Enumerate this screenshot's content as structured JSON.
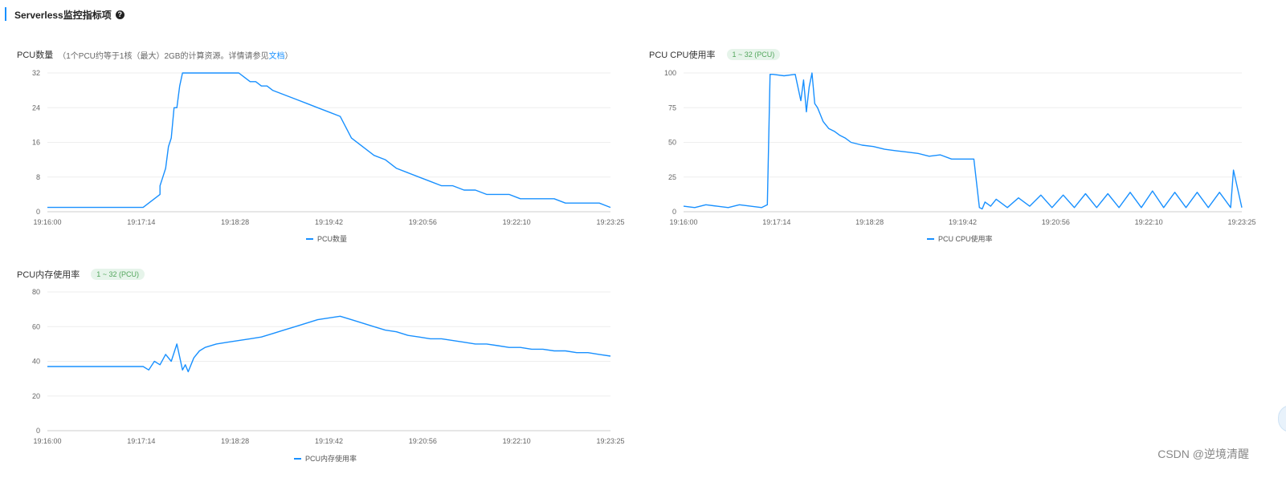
{
  "section": {
    "title": "Serverless监控指标项",
    "help_icon": "question-circle-icon"
  },
  "colors": {
    "series": "#1890ff",
    "badge_bg": "#e6f4ea",
    "badge_text": "#52a65c"
  },
  "charts": {
    "pcu": {
      "title": "PCU数量",
      "subtitle": "（1个PCU约等于1核（最大）2GB的计算资源。详情请参见",
      "link": "文档",
      "subtitle_end": "）",
      "legend": "PCU数量"
    },
    "cpu": {
      "title": "PCU CPU使用率",
      "badge": "1 ~ 32 (PCU)",
      "legend": "PCU CPU使用率"
    },
    "mem": {
      "title": "PCU内存使用率",
      "badge": "1 ~ 32 (PCU)",
      "legend": "PCU内存使用率"
    }
  },
  "watermark": "CSDN @逆境清醒",
  "chart_data": [
    {
      "id": "pcu",
      "type": "line",
      "title": "PCU数量",
      "x_ticks": [
        "19:16:00",
        "19:17:14",
        "19:18:28",
        "19:19:42",
        "19:20:56",
        "19:22:10",
        "19:23:25"
      ],
      "ylim": [
        0,
        32
      ],
      "y_ticks": [
        "0",
        "8",
        "16",
        "24",
        "32"
      ],
      "grid": true,
      "legend_position": "bottom",
      "series": [
        {
          "name": "PCU数量",
          "x": [
            0,
            0.17,
            0.18,
            0.19,
            0.2,
            0.2,
            0.205,
            0.21,
            0.215,
            0.22,
            0.225,
            0.23,
            0.235,
            0.24,
            0.245,
            0.25,
            0.255,
            0.26,
            0.27,
            0.28,
            0.29,
            0.3,
            0.31,
            0.32,
            0.33,
            0.34,
            0.35,
            0.36,
            0.37,
            0.38,
            0.39,
            0.4,
            0.42,
            0.44,
            0.46,
            0.48,
            0.5,
            0.52,
            0.54,
            0.56,
            0.58,
            0.6,
            0.62,
            0.64,
            0.66,
            0.68,
            0.7,
            0.72,
            0.74,
            0.76,
            0.78,
            0.8,
            0.82,
            0.84,
            0.86,
            0.88,
            0.9,
            0.92,
            0.94,
            0.96,
            0.98,
            1.0
          ],
          "y": [
            1,
            1,
            2,
            3,
            4,
            6,
            8,
            10,
            15,
            17,
            24,
            24,
            29,
            32,
            32,
            32,
            32,
            32,
            32,
            32,
            32,
            32,
            32,
            32,
            32,
            32,
            31,
            30,
            30,
            29,
            29,
            28,
            27,
            26,
            25,
            24,
            23,
            22,
            17,
            15,
            13,
            12,
            10,
            9,
            8,
            7,
            6,
            6,
            5,
            5,
            4,
            4,
            4,
            3,
            3,
            3,
            3,
            2,
            2,
            2,
            2,
            1
          ]
        }
      ]
    },
    {
      "id": "cpu",
      "type": "line",
      "title": "PCU CPU使用率",
      "x_ticks": [
        "19:16:00",
        "19:17:14",
        "19:18:28",
        "19:19:42",
        "19:20:56",
        "19:22:10",
        "19:23:25"
      ],
      "ylim": [
        0,
        100
      ],
      "y_ticks": [
        "0",
        "25",
        "50",
        "75",
        "100"
      ],
      "grid": true,
      "legend_position": "bottom",
      "series": [
        {
          "name": "PCU CPU使用率",
          "x": [
            0,
            0.02,
            0.04,
            0.06,
            0.08,
            0.1,
            0.12,
            0.14,
            0.15,
            0.155,
            0.16,
            0.18,
            0.2,
            0.21,
            0.215,
            0.22,
            0.225,
            0.23,
            0.235,
            0.24,
            0.245,
            0.25,
            0.26,
            0.27,
            0.28,
            0.29,
            0.3,
            0.32,
            0.34,
            0.36,
            0.38,
            0.4,
            0.42,
            0.44,
            0.46,
            0.48,
            0.5,
            0.52,
            0.53,
            0.535,
            0.54,
            0.55,
            0.56,
            0.58,
            0.6,
            0.62,
            0.64,
            0.66,
            0.68,
            0.7,
            0.72,
            0.74,
            0.76,
            0.78,
            0.8,
            0.82,
            0.84,
            0.86,
            0.88,
            0.9,
            0.92,
            0.94,
            0.96,
            0.98,
            0.985,
            1.0
          ],
          "y": [
            4,
            3,
            5,
            4,
            3,
            5,
            4,
            3,
            5,
            99,
            99,
            98,
            99,
            80,
            95,
            72,
            90,
            100,
            78,
            75,
            70,
            65,
            60,
            58,
            55,
            53,
            50,
            48,
            47,
            45,
            44,
            43,
            42,
            40,
            41,
            38,
            38,
            38,
            3,
            2,
            7,
            4,
            9,
            3,
            10,
            4,
            12,
            3,
            12,
            3,
            13,
            3,
            13,
            3,
            14,
            3,
            15,
            3,
            14,
            3,
            14,
            3,
            14,
            3,
            30,
            3
          ]
        }
      ]
    },
    {
      "id": "mem",
      "type": "line",
      "title": "PCU内存使用率",
      "x_ticks": [
        "19:16:00",
        "19:17:14",
        "19:18:28",
        "19:19:42",
        "19:20:56",
        "19:22:10",
        "19:23:25"
      ],
      "ylim": [
        0,
        80
      ],
      "y_ticks": [
        "0",
        "20",
        "40",
        "60",
        "80"
      ],
      "grid": true,
      "legend_position": "bottom",
      "series": [
        {
          "name": "PCU内存使用率",
          "x": [
            0,
            0.05,
            0.1,
            0.15,
            0.17,
            0.18,
            0.19,
            0.2,
            0.21,
            0.22,
            0.23,
            0.24,
            0.245,
            0.25,
            0.26,
            0.27,
            0.28,
            0.3,
            0.32,
            0.34,
            0.36,
            0.38,
            0.4,
            0.42,
            0.44,
            0.46,
            0.48,
            0.5,
            0.52,
            0.54,
            0.56,
            0.58,
            0.6,
            0.62,
            0.64,
            0.66,
            0.68,
            0.7,
            0.72,
            0.74,
            0.76,
            0.78,
            0.8,
            0.82,
            0.84,
            0.86,
            0.88,
            0.9,
            0.92,
            0.94,
            0.96,
            0.98,
            1.0
          ],
          "y": [
            37,
            37,
            37,
            37,
            37,
            35,
            40,
            38,
            44,
            40,
            50,
            35,
            38,
            34,
            42,
            46,
            48,
            50,
            51,
            52,
            53,
            54,
            56,
            58,
            60,
            62,
            64,
            65,
            66,
            64,
            62,
            60,
            58,
            57,
            55,
            54,
            53,
            53,
            52,
            51,
            50,
            50,
            49,
            48,
            48,
            47,
            47,
            46,
            46,
            45,
            45,
            44,
            43
          ]
        }
      ]
    }
  ]
}
